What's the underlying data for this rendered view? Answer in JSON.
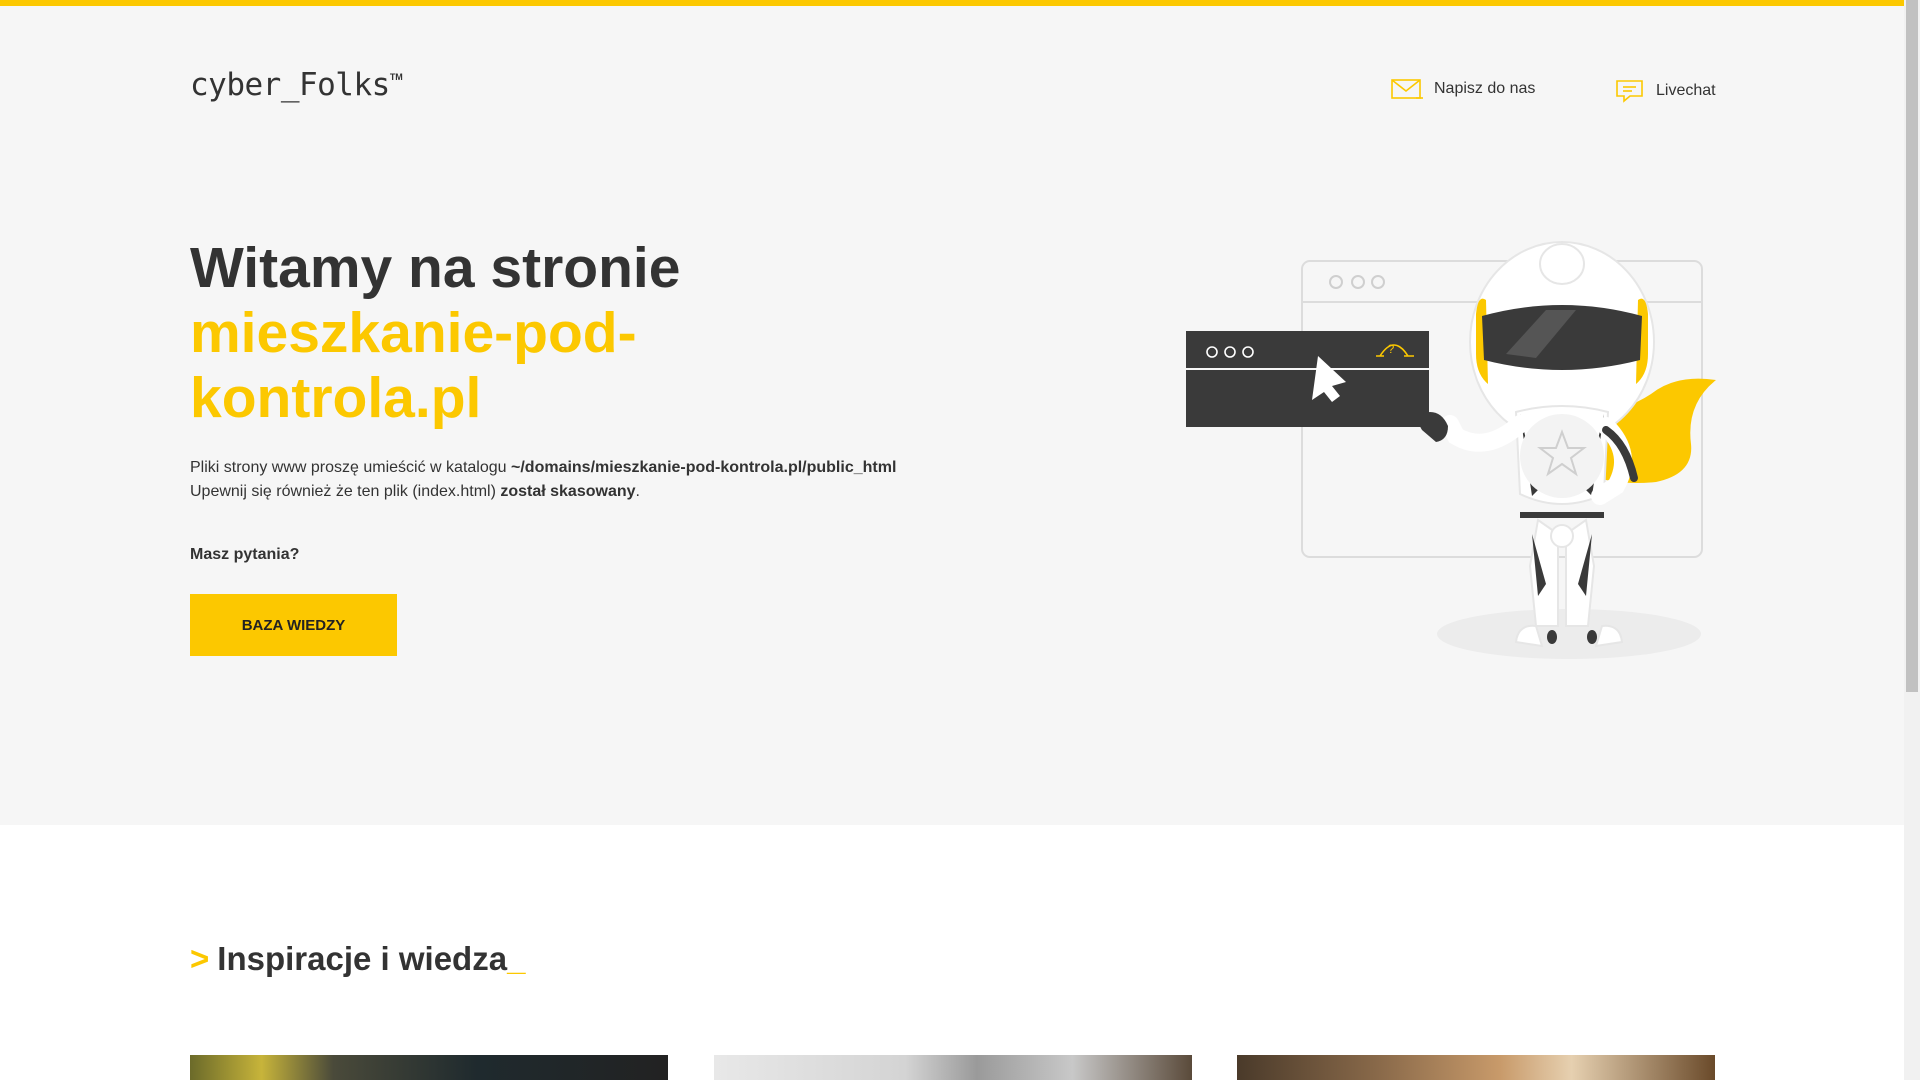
{
  "header": {
    "logo_text": "cyber_Folks",
    "logo_tm": "TM",
    "nav": {
      "mail_label": "Napisz do nas",
      "chat_label": "Livechat"
    }
  },
  "hero": {
    "title_line1": "Witamy na stronie",
    "domain": "mieszkanie-pod-kontrola.pl",
    "desc_line1_prefix": "Pliki strony www proszę umieścić w katalogu ",
    "desc_line1_path": "~/domains/mieszkanie-pod-kontrola.pl/public_html",
    "desc_line2_prefix": "Upewnij się również że ten plik (index.html) ",
    "desc_line2_bold": "został skasowany",
    "desc_line2_suffix": ".",
    "questions": "Masz pytania?",
    "button_label": "BAZA WIEDZY"
  },
  "section": {
    "gt": ">",
    "title": "Inspiracje i wiedza",
    "underscore": "_"
  },
  "colors": {
    "accent": "#fcc800",
    "text": "#333333",
    "hero_bg": "#f6f6f6"
  },
  "icons": {
    "mail": "mail-icon",
    "chat": "chat-icon"
  }
}
